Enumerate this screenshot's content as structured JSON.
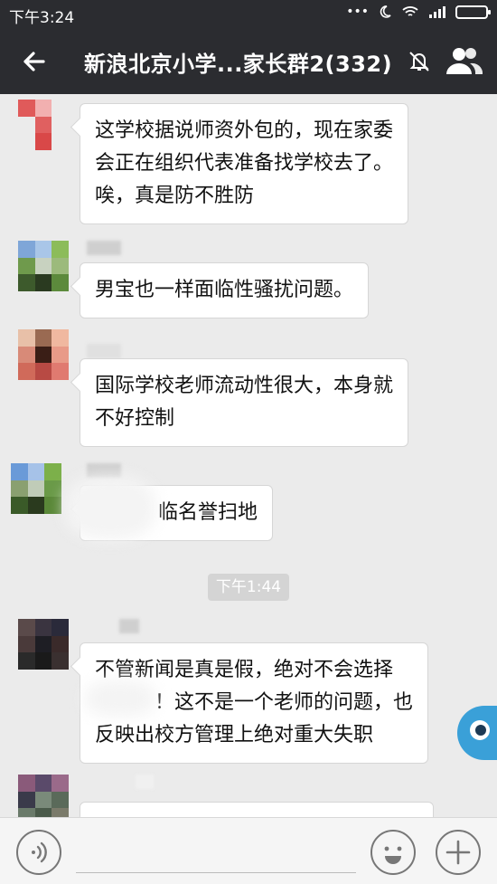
{
  "status_bar": {
    "time": "下午3:24",
    "dots": "•••"
  },
  "header": {
    "title": "新浪北京小学...家长群2(332)"
  },
  "messages": [
    {
      "lines": [
        "这学校据说师资外包的，现在家委",
        "会正在组织代表准备找学校去了。",
        "唉，真是防不胜防"
      ]
    },
    {
      "lines": [
        "男宝也一样面临性骚扰问题。"
      ]
    },
    {
      "lines": [
        "国际学校老师流动性很大，本身就",
        "不好控制"
      ]
    },
    {
      "lines": [
        "临名誉扫地"
      ]
    },
    {
      "lines": [
        "不管新闻是真是假，绝对不会选择",
        "！这不是一个老师的问题，也",
        "反映出校方管理上绝对重大失职"
      ]
    }
  ],
  "timestamp": "下午1:44",
  "colors": {
    "header_bg": "#2b2c30",
    "chat_bg": "#ebebeb",
    "bubble_bg": "#ffffff",
    "assist_blue": "#3aa0d8"
  },
  "icons": [
    "back-arrow-icon",
    "mute-bell-icon",
    "group-members-icon",
    "voice-icon",
    "emoji-icon",
    "plus-icon",
    "wifi-icon",
    "signal-icon",
    "battery-icon",
    "moon-icon"
  ]
}
